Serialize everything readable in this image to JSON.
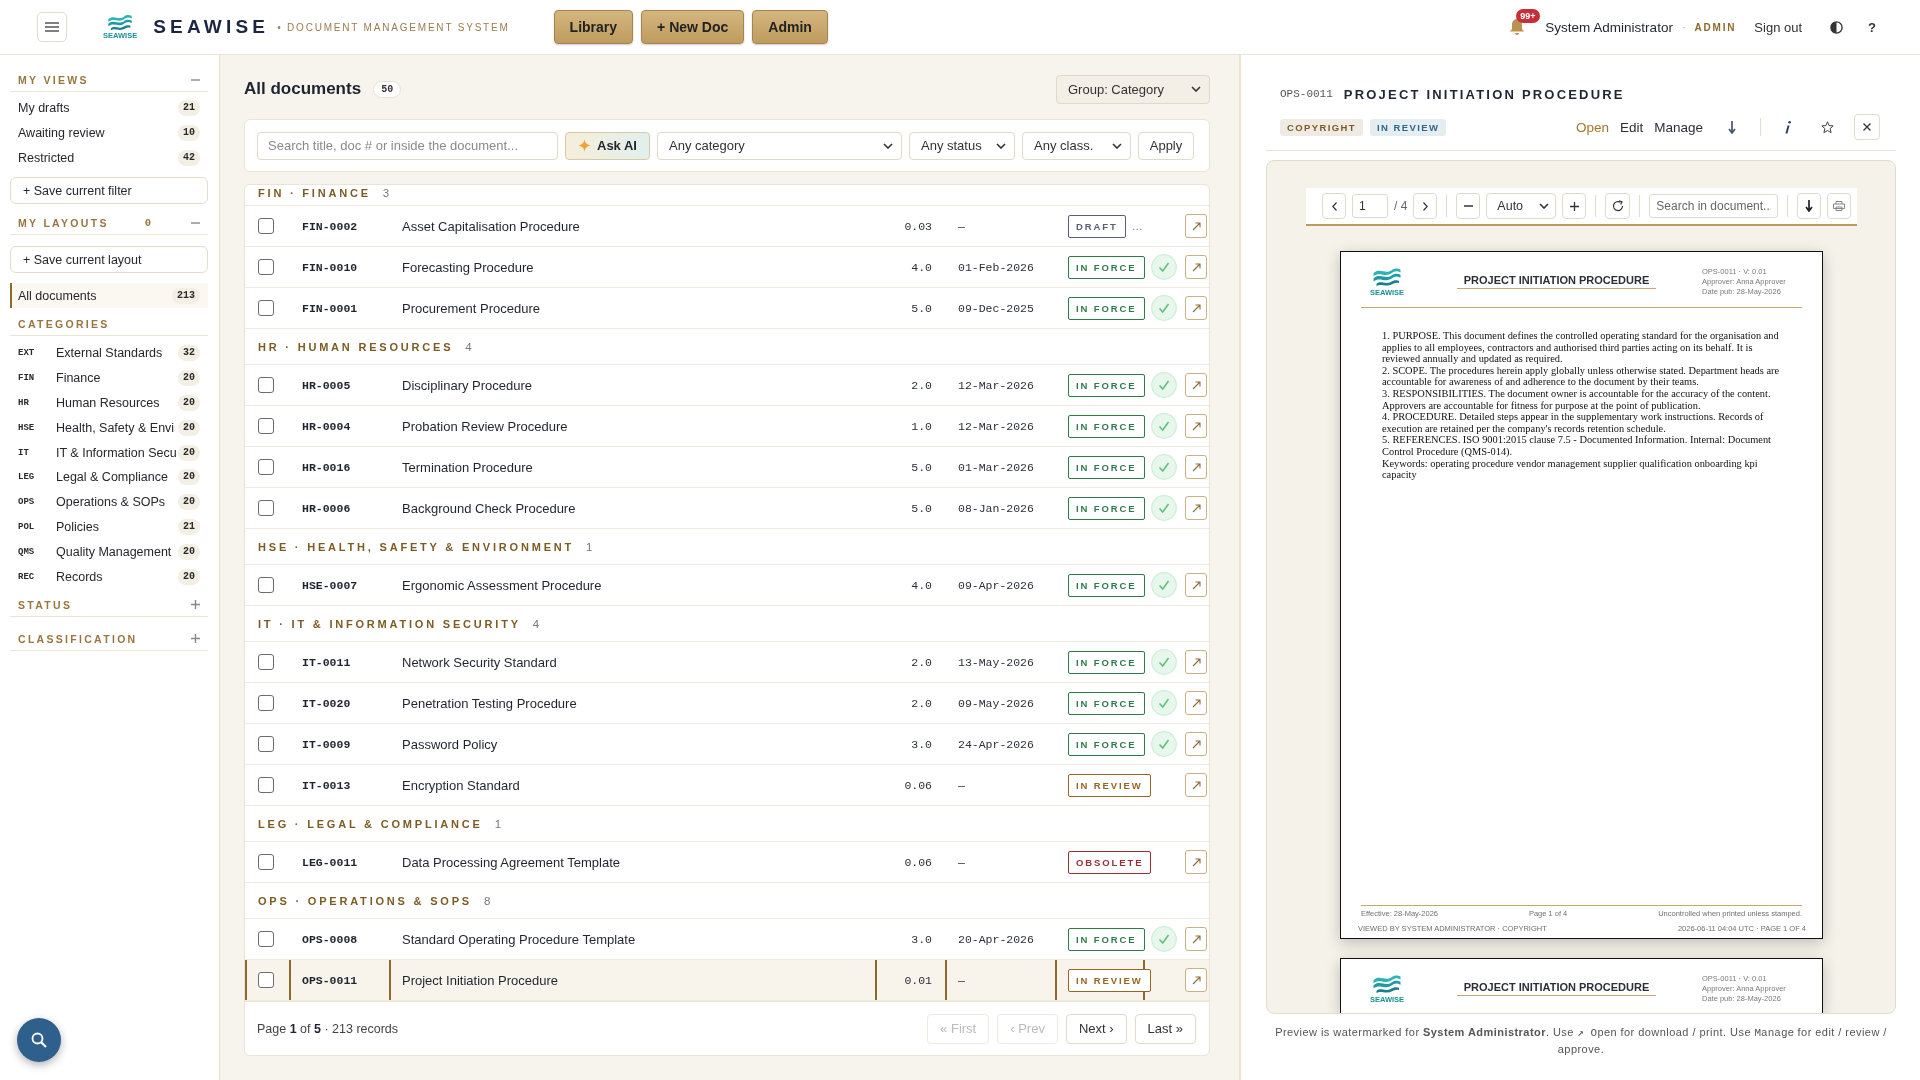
{
  "header": {
    "logo_text": "SEAWISE",
    "brand": "SEAWISE",
    "tagline": "• DOCUMENT MANAGEMENT SYSTEM",
    "nav": [
      {
        "label": "Library"
      },
      {
        "label": "+ New Doc"
      },
      {
        "label": "Admin"
      }
    ],
    "notifications": "99+",
    "user": "System Administrator",
    "separator": "·",
    "role": "ADMIN",
    "sign_out": "Sign out",
    "help": "?"
  },
  "sidebar": {
    "views": {
      "title": "MY VIEWS",
      "expanded": true,
      "items": [
        {
          "label": "My drafts",
          "count": "21",
          "selected": false
        },
        {
          "label": "Awaiting review",
          "count": "10",
          "selected": false
        },
        {
          "label": "Restricted",
          "count": "42",
          "selected": false
        }
      ],
      "save_button": "+ Save current filter"
    },
    "layouts": {
      "title": "MY LAYOUTS",
      "count": "0",
      "expanded": true,
      "save_button": "+ Save current layout"
    },
    "all_documents": {
      "label": "All documents",
      "count": "213",
      "selected": true
    },
    "categories": {
      "title": "CATEGORIES",
      "items": [
        {
          "code": "EXT",
          "label": "External Standards",
          "count": "32",
          "selected": false
        },
        {
          "code": "FIN",
          "label": "Finance",
          "count": "20",
          "selected": false
        },
        {
          "code": "HR",
          "label": "Human Resources",
          "count": "20",
          "selected": false
        },
        {
          "code": "HSE",
          "label": "Health, Safety & Envi",
          "count": "20",
          "selected": false
        },
        {
          "code": "IT",
          "label": "IT & Information Secu",
          "count": "20",
          "selected": false
        },
        {
          "code": "LEG",
          "label": "Legal & Compliance",
          "count": "20",
          "selected": false
        },
        {
          "code": "OPS",
          "label": "Operations & SOPs",
          "count": "20",
          "selected": false
        },
        {
          "code": "POL",
          "label": "Policies",
          "count": "21",
          "selected": false
        },
        {
          "code": "QMS",
          "label": "Quality Management",
          "count": "20",
          "selected": false
        },
        {
          "code": "REC",
          "label": "Records",
          "count": "20",
          "selected": false
        }
      ]
    },
    "filters": [
      {
        "title": "STATUS",
        "expanded": false
      },
      {
        "title": "CLASSIFICATION",
        "expanded": false
      }
    ]
  },
  "documents": {
    "title": "All documents",
    "count": "50",
    "group_by": "Group: Category",
    "filters": {
      "search": {
        "placeholder": "Search title, doc # or inside the document..."
      },
      "ask_ai": "Ask AI",
      "selects": [
        "Any category",
        "Any status",
        "Any class."
      ],
      "apply": "Apply"
    },
    "groups": [
      {
        "label": "FIN · FINANCE",
        "count": "3",
        "rows": [
          {
            "checked": false,
            "selected": false,
            "doc_number": "FIN-0002",
            "title": "Asset Capitalisation Procedure",
            "version": "0.03",
            "date": "—",
            "status": {
              "label": "DRAFT",
              "color": "#5a5f78"
            },
            "ellipsis": "…",
            "approved": false
          },
          {
            "checked": false,
            "selected": false,
            "doc_number": "FIN-0010",
            "title": "Forecasting Procedure",
            "version": "4.0",
            "date": "01-Feb-2026",
            "status": {
              "label": "IN FORCE",
              "color": "#2f7a4c"
            },
            "approved": true
          },
          {
            "checked": false,
            "selected": false,
            "doc_number": "FIN-0001",
            "title": "Procurement Procedure",
            "version": "5.0",
            "date": "09-Dec-2025",
            "status": {
              "label": "IN FORCE",
              "color": "#2f7a4c"
            },
            "approved": true
          }
        ]
      },
      {
        "label": "HR · HUMAN RESOURCES",
        "count": "4",
        "rows": [
          {
            "checked": false,
            "selected": false,
            "doc_number": "HR-0005",
            "title": "Disciplinary Procedure",
            "version": "2.0",
            "date": "12-Mar-2026",
            "status": {
              "label": "IN FORCE",
              "color": "#2f7a4c"
            },
            "approved": true
          },
          {
            "checked": false,
            "selected": false,
            "doc_number": "HR-0004",
            "title": "Probation Review Procedure",
            "version": "1.0",
            "date": "12-Mar-2026",
            "status": {
              "label": "IN FORCE",
              "color": "#2f7a4c"
            },
            "approved": true
          },
          {
            "checked": false,
            "selected": false,
            "doc_number": "HR-0016",
            "title": "Termination Procedure",
            "version": "5.0",
            "date": "01-Mar-2026",
            "status": {
              "label": "IN FORCE",
              "color": "#2f7a4c"
            },
            "approved": true
          },
          {
            "checked": false,
            "selected": false,
            "doc_number": "HR-0006",
            "title": "Background Check Procedure",
            "version": "5.0",
            "date": "08-Jan-2026",
            "status": {
              "label": "IN FORCE",
              "color": "#2f7a4c"
            },
            "approved": true
          }
        ]
      },
      {
        "label": "HSE · HEALTH, SAFETY & ENVIRONMENT",
        "count": "1",
        "rows": [
          {
            "checked": false,
            "selected": false,
            "doc_number": "HSE-0007",
            "title": "Ergonomic Assessment Procedure",
            "version": "4.0",
            "date": "09-Apr-2026",
            "status": {
              "label": "IN FORCE",
              "color": "#2f7a4c"
            },
            "approved": true
          }
        ]
      },
      {
        "label": "IT · IT & INFORMATION SECURITY",
        "count": "4",
        "rows": [
          {
            "checked": false,
            "selected": false,
            "doc_number": "IT-0011",
            "title": "Network Security Standard",
            "version": "2.0",
            "date": "13-May-2026",
            "status": {
              "label": "IN FORCE",
              "color": "#2f7a4c"
            },
            "approved": true
          },
          {
            "checked": false,
            "selected": false,
            "doc_number": "IT-0020",
            "title": "Penetration Testing Procedure",
            "version": "2.0",
            "date": "09-May-2026",
            "status": {
              "label": "IN FORCE",
              "color": "#2f7a4c"
            },
            "approved": true
          },
          {
            "checked": false,
            "selected": false,
            "doc_number": "IT-0009",
            "title": "Password Policy",
            "version": "3.0",
            "date": "24-Apr-2026",
            "status": {
              "label": "IN FORCE",
              "color": "#2f7a4c"
            },
            "approved": true
          },
          {
            "checked": false,
            "selected": false,
            "doc_number": "IT-0013",
            "title": "Encryption Standard",
            "version": "0.06",
            "date": "—",
            "status": {
              "label": "IN REVIEW",
              "color": "#9a6424"
            },
            "approved": false
          }
        ]
      },
      {
        "label": "LEG · LEGAL & COMPLIANCE",
        "count": "1",
        "rows": [
          {
            "checked": false,
            "selected": false,
            "doc_number": "LEG-0011",
            "title": "Data Processing Agreement Template",
            "version": "0.06",
            "date": "—",
            "status": {
              "label": "OBSOLETE",
              "color": "#9b2d35"
            },
            "approved": false
          }
        ]
      },
      {
        "label": "OPS · OPERATIONS & SOPS",
        "count": "8",
        "rows": [
          {
            "checked": false,
            "selected": false,
            "doc_number": "OPS-0008",
            "title": "Standard Operating Procedure Template",
            "version": "3.0",
            "date": "20-Apr-2026",
            "status": {
              "label": "IN FORCE",
              "color": "#2f7a4c"
            },
            "approved": true
          },
          {
            "checked": false,
            "selected": true,
            "doc_number": "OPS-0011",
            "title": "Project Initiation Procedure",
            "version": "0.01",
            "date": "—",
            "status": {
              "label": "IN REVIEW",
              "color": "#9a6424"
            },
            "approved": false
          }
        ]
      }
    ],
    "pagination": {
      "summary": "Page **1** of **5** · 213 records",
      "buttons": [
        {
          "label": "« First",
          "disabled": true
        },
        {
          "label": "‹ Prev",
          "disabled": true
        },
        {
          "label": "Next ›",
          "disabled": false
        },
        {
          "label": "Last »",
          "disabled": false
        }
      ]
    }
  },
  "preview": {
    "doc_number": "OPS-0011",
    "title": "PROJECT INITIATION PROCEDURE",
    "tags": [
      {
        "label": "COPYRIGHT",
        "color": "#7a5a22"
      },
      {
        "label": "IN REVIEW",
        "color": "#2a6a8e"
      }
    ],
    "actions": [
      {
        "label": "Open",
        "kind": "primary"
      },
      {
        "label": "Edit",
        "kind": "plain"
      },
      {
        "label": "Manage",
        "kind": "plain"
      }
    ],
    "viewer": {
      "page": "1",
      "page_total": "/ 4",
      "zoom": "Auto",
      "search": {
        "placeholder": "Search in document..."
      },
      "pages": [
        {
          "logo_text": "SEAWISE",
          "title": "PROJECT INITIATION PROCEDURE",
          "meta": [
            "OPS-0011 · V: 0.01",
            "Approver: Anna Approver",
            "Date pub: 28-May-2026"
          ],
          "body": [
            "1. PURPOSE. This document defines the controlled operating standard for the organisation and applies to all employees, contractors and authorised third parties acting on its behalf. It is reviewed annually and updated as required.",
            "2. SCOPE. The procedures herein apply globally unless otherwise stated. Department heads are accountable for awareness of and adherence to the document by their teams.",
            "3. RESPONSIBILITIES. The document owner is accountable for the accuracy of the content. Approvers are accountable for fitness for purpose at the point of publication.",
            "4. PROCEDURE. Detailed steps appear in the supplementary work instructions. Records of execution are retained per the company's records retention schedule.",
            "5. REFERENCES. ISO 9001:2015 clause 7.5 - Documented Information. Internal: Document Control Procedure (QMS-014).",
            "Keywords: operating procedure vendor management supplier qualification onboarding kpi capacity"
          ],
          "footer": {
            "effective": "Effective: 28-May-2026",
            "page": "Page 1 of 4",
            "notice": "Uncontrolled when printed unless stamped.",
            "viewed_by": "VIEWED BY SYSTEM ADMINISTRATOR · COPYRIGHT",
            "timestamp": "2026-06-11 04:04 UTC · PAGE 1 OF 4"
          }
        },
        {
          "logo_text": "SEAWISE",
          "title": "PROJECT INITIATION PROCEDURE",
          "meta": [
            "OPS-0011 · V: 0.01",
            "Approver: Anna Approver",
            "Date pub: 28-May-2026"
          ]
        }
      ]
    },
    "caption": [
      {
        "kind": "text",
        "text": "Preview is watermarked for "
      },
      {
        "kind": "bold",
        "text": "System Administrator"
      },
      {
        "kind": "text",
        "text": ". Use "
      },
      {
        "kind": "code",
        "text": "↗ Open"
      },
      {
        "kind": "text",
        "text": " for download / print. Use "
      },
      {
        "kind": "code",
        "text": "Manage"
      },
      {
        "kind": "text",
        "text": " for edit / review / approve."
      }
    ]
  }
}
